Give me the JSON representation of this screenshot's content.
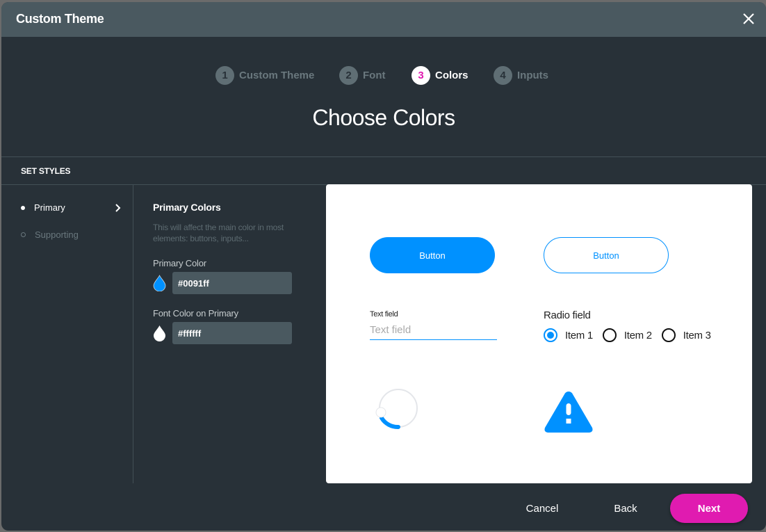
{
  "dialog": {
    "title": "Custom Theme",
    "close_icon": "close-icon"
  },
  "stepper": {
    "steps": [
      {
        "number": "1",
        "label": "Custom Theme",
        "state": "inactive"
      },
      {
        "number": "2",
        "label": "Font",
        "state": "inactive"
      },
      {
        "number": "3",
        "label": "Colors",
        "state": "active"
      },
      {
        "number": "4",
        "label": "Inputs",
        "state": "inactive"
      }
    ]
  },
  "page": {
    "title": "Choose Colors",
    "section_header": "SET STYLES"
  },
  "sidebar": {
    "items": [
      {
        "label": "Primary",
        "selected": true,
        "icon": "chevron-right-icon"
      },
      {
        "label": "Supporting",
        "selected": false
      }
    ]
  },
  "primary_colors": {
    "heading": "Primary Colors",
    "description": "This will affect the main color in most elements: buttons, inputs...",
    "fields": [
      {
        "label": "Primary Color",
        "value": "#0091ff",
        "swatch": "#0091ff",
        "icon": "drop-icon"
      },
      {
        "label": "Font Color on Primary",
        "value": "#ffffff",
        "swatch": "#ffffff",
        "icon": "drop-icon"
      }
    ]
  },
  "preview": {
    "filled_button_label": "Button",
    "outline_button_label": "Button",
    "text_field": {
      "label": "Text field",
      "placeholder": "Text field",
      "value": ""
    },
    "radio_field": {
      "label": "Radio field",
      "options": [
        "Item 1",
        "Item 2",
        "Item 3"
      ],
      "selected_index": 0
    },
    "spinner_icon": "loading-spinner-icon",
    "warning_icon": "warning-triangle-icon"
  },
  "footer": {
    "cancel_label": "Cancel",
    "back_label": "Back",
    "next_label": "Next"
  },
  "colors": {
    "primary": "#0091ff",
    "accent": "#e01bb0",
    "dialog_bg": "#283138",
    "titlebar_bg": "#4a5960"
  }
}
